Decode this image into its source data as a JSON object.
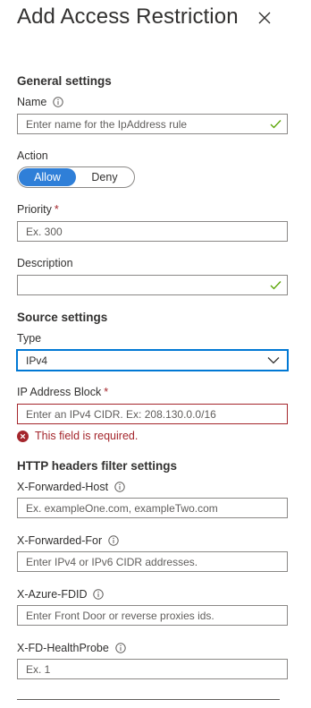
{
  "panel": {
    "title": "Add Access Restriction"
  },
  "general": {
    "heading": "General settings",
    "name_label": "Name",
    "name_placeholder": "Enter name for the IpAddress rule",
    "action_label": "Action",
    "action_options": [
      "Allow",
      "Deny"
    ],
    "action_selected": "Allow",
    "priority_label": "Priority",
    "priority_required": "*",
    "priority_placeholder": "Ex. 300",
    "description_label": "Description",
    "description_value": ""
  },
  "source": {
    "heading": "Source settings",
    "type_label": "Type",
    "type_value": "IPv4",
    "ip_label": "IP Address Block",
    "ip_required": "*",
    "ip_placeholder": "Enter an IPv4 CIDR. Ex: 208.130.0.0/16",
    "ip_error": "This field is required."
  },
  "headers": {
    "heading": "HTTP headers filter settings",
    "forwarded_host_label": "X-Forwarded-Host",
    "forwarded_host_placeholder": "Ex. exampleOne.com, exampleTwo.com",
    "forwarded_for_label": "X-Forwarded-For",
    "forwarded_for_placeholder": "Enter IPv4 or IPv6 CIDR addresses.",
    "azure_fdid_label": "X-Azure-FDID",
    "azure_fdid_placeholder": "Enter Front Door or reverse proxies ids.",
    "fd_healthprobe_label": "X-FD-HealthProbe",
    "fd_healthprobe_placeholder": "Ex. 1"
  },
  "colors": {
    "accent": "#0078d4",
    "toggle_on": "#2f7fd8",
    "error": "#a4262c",
    "valid_check": "#57a300"
  }
}
